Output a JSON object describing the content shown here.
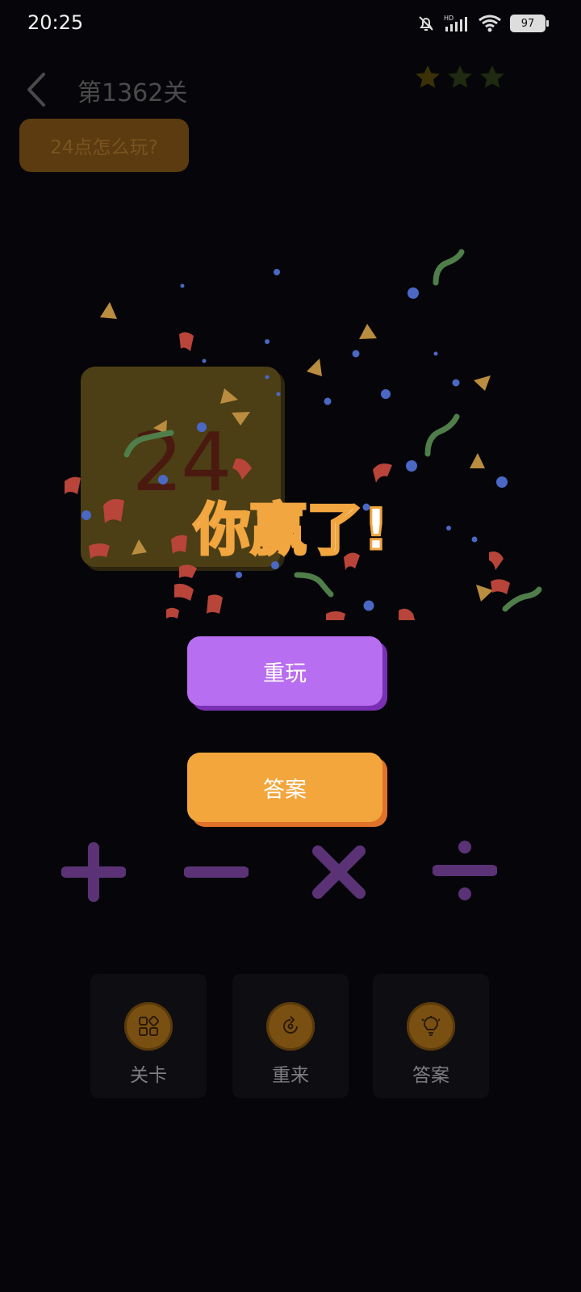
{
  "status_bar": {
    "time": "20:25",
    "battery": "97"
  },
  "header": {
    "level_title": "第1362关",
    "stars_total": 3,
    "stars_earned": 0
  },
  "howto": {
    "label": "24点怎么玩?"
  },
  "card": {
    "value": "24"
  },
  "result": {
    "text": "你赢了!"
  },
  "actions": {
    "replay_label": "重玩",
    "answer_label": "答案"
  },
  "operators": [
    "plus",
    "minus",
    "multiply",
    "divide"
  ],
  "tabs": [
    {
      "label": "关卡",
      "icon": "grid-icon"
    },
    {
      "label": "重来",
      "icon": "restart-icon"
    },
    {
      "label": "答案",
      "icon": "lightbulb-icon"
    }
  ],
  "colors": {
    "background": "#06060a",
    "replay": "#b86ef0",
    "answer": "#f2a63c",
    "operator": "#5a3275",
    "win_stroke": "#f2a640"
  }
}
